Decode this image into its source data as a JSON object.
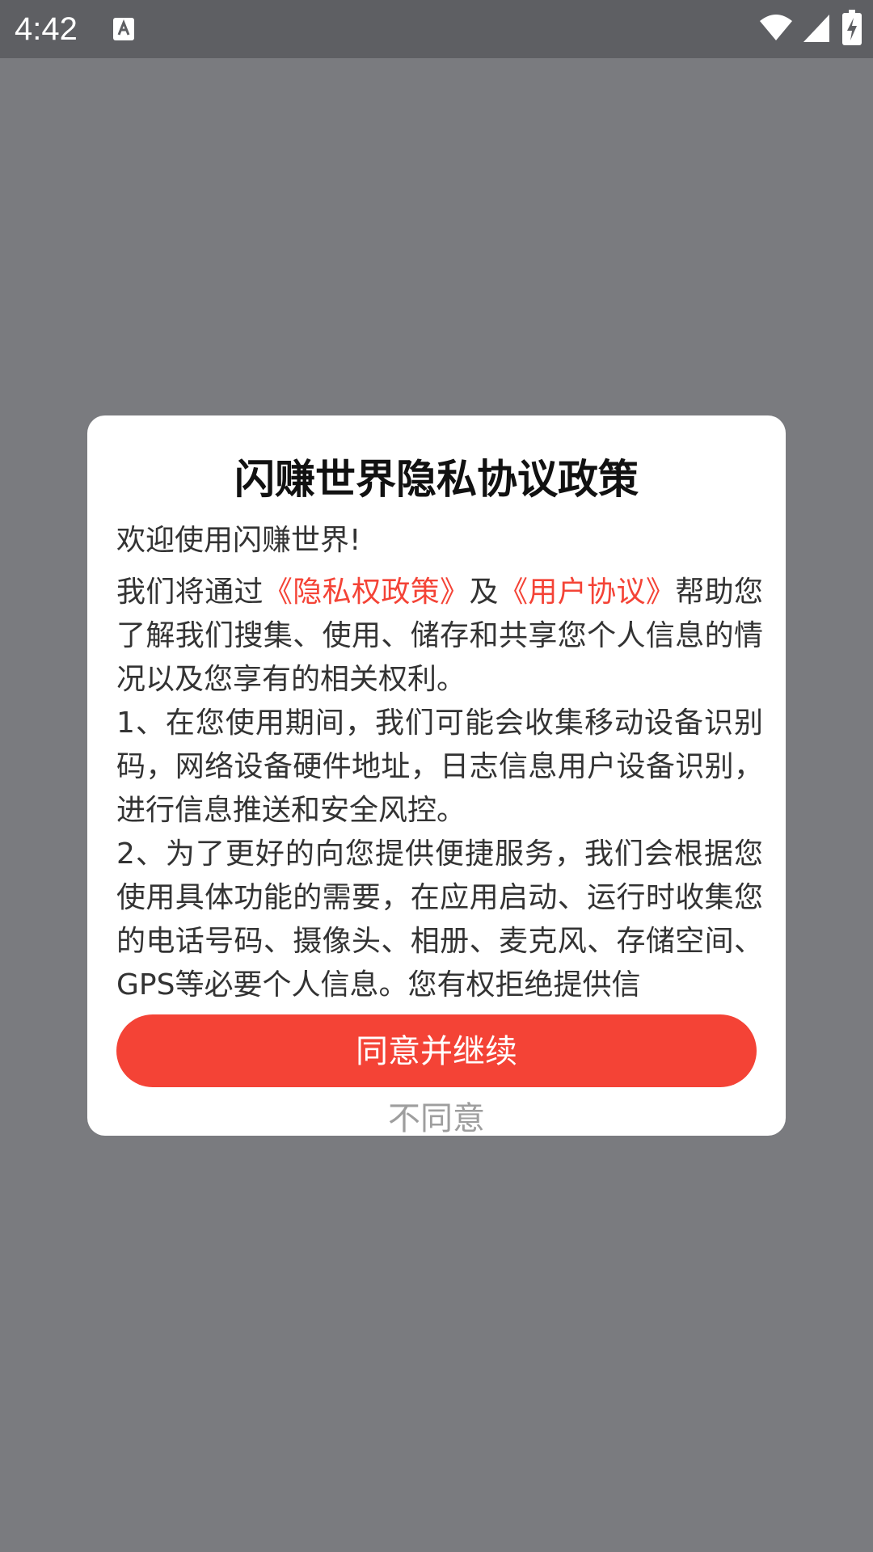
{
  "status_bar": {
    "time": "4:42",
    "notification_icon": "text-a-icon",
    "icons": [
      "wifi-icon",
      "signal-icon",
      "battery-charging-icon"
    ]
  },
  "dialog": {
    "title": "闪赚世界隐私协议政策",
    "greeting": "欢迎使用闪赚世界!",
    "intro_prefix": "我们将通过",
    "privacy_link": "《隐私权政策》",
    "intro_and": "及",
    "user_agreement_link": "《用户协议》",
    "intro_suffix": "帮助您了解我们搜集、使用、储存和共享您个人信息的情况以及您享有的相关权利。",
    "item1": "1、在您使用期间，我们可能会收集移动设备识别码，网络设备硬件地址，日志信息用户设备识别，进行信息推送和安全风控。",
    "item2": "2、为了更好的向您提供便捷服务，我们会根据您使用具体功能的需要，在应用启动、运行时收集您的电话号码、摄像头、相册、麦克风、存储空间、GPS等必要个人信息。您有权拒绝提供信",
    "agree_label": "同意并继续",
    "disagree_label": "不同意"
  },
  "colors": {
    "accent": "#f44336",
    "overlay": "#7a7b7f",
    "status_bar": "#5e5f63",
    "dialog_bg": "#ffffff",
    "disagree_text": "#9e9e9e"
  }
}
